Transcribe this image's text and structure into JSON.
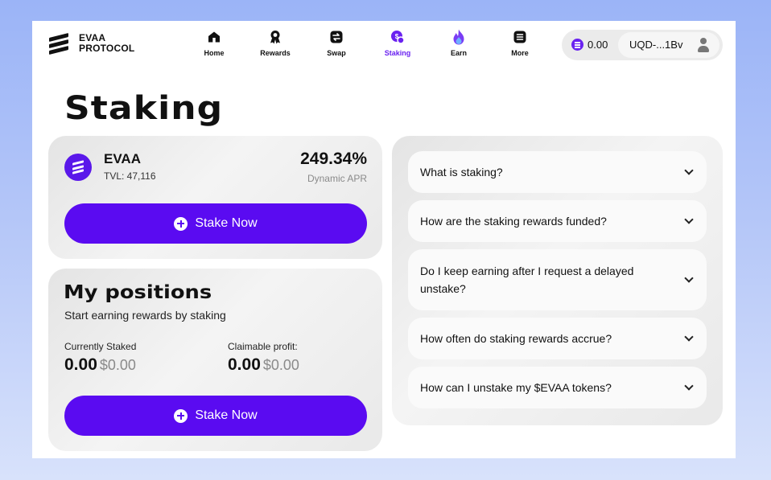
{
  "brand": {
    "line1": "EVAA",
    "line2": "PROTOCOL"
  },
  "nav": {
    "items": [
      {
        "label": "Home",
        "icon": "home-icon"
      },
      {
        "label": "Rewards",
        "icon": "rewards-icon"
      },
      {
        "label": "Swap",
        "icon": "swap-icon"
      },
      {
        "label": "Staking",
        "icon": "staking-icon",
        "active": true
      },
      {
        "label": "Earn",
        "icon": "fire-icon"
      },
      {
        "label": "More",
        "icon": "more-icon"
      }
    ],
    "active_color": "#6a22f0"
  },
  "wallet": {
    "balance": "0.00",
    "address": "UQD-...1Bv"
  },
  "page": {
    "title": "Staking"
  },
  "pool": {
    "name": "EVAA",
    "tvl": "TVL: 47,116",
    "apr": "249.34%",
    "apr_label": "Dynamic APR",
    "button": "Stake Now"
  },
  "positions": {
    "title": "My positions",
    "subtitle": "Start earning rewards by staking",
    "staked_label": "Currently Staked",
    "staked_value": "0.00",
    "staked_usd": "$0.00",
    "profit_label": "Claimable profit:",
    "profit_value": "0.00",
    "profit_usd": "$0.00",
    "button": "Stake Now"
  },
  "faq": [
    {
      "question": "What is staking?"
    },
    {
      "question": "How are the staking rewards funded?"
    },
    {
      "question": "Do I keep earning after I request a delayed unstake?"
    },
    {
      "question": "How often do staking rewards accrue?"
    },
    {
      "question": "How can I unstake my $EVAA tokens?"
    }
  ],
  "colors": {
    "brand_purple": "#5a0bf1",
    "background_top": "#9bb4f7",
    "card": "#eeeeee"
  }
}
